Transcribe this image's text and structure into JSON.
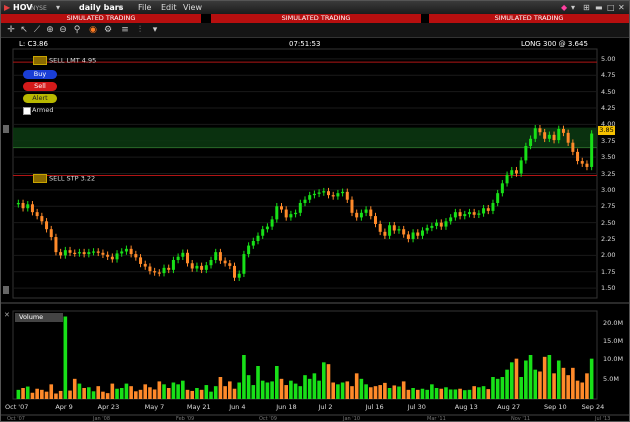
{
  "titlebar": {
    "symbol": "HOV",
    "exchange": "NYSE",
    "period": "daily bars",
    "menu": [
      "File",
      "Edit",
      "View"
    ]
  },
  "banner": [
    "SIMULATED TRADING",
    "SIMULATED TRADING",
    "SIMULATED TRADING"
  ],
  "header": {
    "last": "L: C3.86",
    "time": "07:51:53",
    "position": "LONG 300 @ 3.645"
  },
  "trade_buttons": [
    "Buy",
    "Sell",
    "Alert"
  ],
  "armed_label": "Armed",
  "orders": {
    "sell_limit": "SELL LMT 4.95",
    "sell_stop": "SELL STP 3.22"
  },
  "price_label": "3.85",
  "volume_label": "Volume",
  "volume_ticks": [
    "20.0M",
    "15.0M",
    "10.0M",
    "5.0M"
  ],
  "colors": {
    "up": "#18e018",
    "down": "#ff8a2a",
    "neutral": "#f0f000",
    "banner": "#b70f0f",
    "order_line": "#b01515"
  },
  "timeline_strip": [
    "Oct '07",
    "Jan '08",
    "Feb '09",
    "Oct '09",
    "Jan '10",
    "Mar '11",
    "Nov '11",
    "Jul '13"
  ],
  "chart_data": {
    "type": "candlestick",
    "price_axis": {
      "ticks": [
        "5.00",
        "4.75",
        "4.50",
        "4.25",
        "4.00",
        "3.75",
        "3.50",
        "3.25",
        "3.00",
        "2.75",
        "2.50",
        "2.25",
        "2.00",
        "1.75",
        "1.50"
      ],
      "ylim": [
        1.35,
        5.15
      ]
    },
    "x_ticks": [
      "Apr 9",
      "Apr 23",
      "May 7",
      "May 21",
      "Jun 4",
      "Jun 18",
      "Jul 2",
      "Jul 16",
      "Jul 30",
      "Aug 13",
      "Aug 27",
      "Sep 10",
      "Sep 24"
    ],
    "first_x_label": "Oct '07",
    "overlays": {
      "sell_limit": 4.95,
      "sell_stop": 3.22,
      "position_cost": 3.645,
      "highlight_band": [
        3.645,
        3.95
      ]
    },
    "close": [
      2.8,
      2.72,
      2.78,
      2.66,
      2.6,
      2.52,
      2.4,
      2.28,
      2.05,
      2.0,
      2.08,
      2.04,
      2.03,
      2.05,
      2.02,
      2.05,
      2.06,
      2.04,
      2.01,
      1.98,
      1.94,
      2.03,
      2.06,
      2.1,
      2.02,
      1.97,
      1.87,
      1.83,
      1.76,
      1.74,
      1.73,
      1.81,
      1.78,
      1.93,
      1.98,
      2.04,
      1.88,
      1.8,
      1.84,
      1.78,
      1.85,
      1.93,
      2.05,
      1.92,
      1.88,
      1.84,
      1.66,
      1.72,
      2.02,
      2.15,
      2.22,
      2.3,
      2.4,
      2.44,
      2.55,
      2.75,
      2.7,
      2.58,
      2.63,
      2.65,
      2.8,
      2.85,
      2.92,
      2.94,
      2.96,
      2.98,
      2.92,
      2.9,
      2.95,
      2.97,
      2.85,
      2.65,
      2.58,
      2.65,
      2.7,
      2.6,
      2.48,
      2.36,
      2.3,
      2.46,
      2.38,
      2.4,
      2.32,
      2.25,
      2.35,
      2.3,
      2.38,
      2.42,
      2.45,
      2.5,
      2.44,
      2.52,
      2.58,
      2.66,
      2.6,
      2.63,
      2.66,
      2.62,
      2.64,
      2.72,
      2.68,
      2.8,
      2.95,
      3.1,
      3.23,
      3.3,
      3.25,
      3.45,
      3.67,
      3.78,
      3.94,
      3.88,
      3.78,
      3.84,
      3.76,
      3.93,
      3.87,
      3.72,
      3.58,
      3.44,
      3.4,
      3.35,
      3.86
    ],
    "volume_millions": [
      2.5,
      3.0,
      3.4,
      1.7,
      2.8,
      2.5,
      2.0,
      4.0,
      1.5,
      2.2,
      22.5,
      2.3,
      5.5,
      4.2,
      3.0,
      3.2,
      2.1,
      3.5,
      2.0,
      1.6,
      4.2,
      2.8,
      3.0,
      4.2,
      3.5,
      2.1,
      2.5,
      4.0,
      3.2,
      2.6,
      4.8,
      4.0,
      3.0,
      4.5,
      4.0,
      5.0,
      2.5,
      2.2,
      3.0,
      2.5,
      3.8,
      2.0,
      3.5,
      6.0,
      3.5,
      4.8,
      2.8,
      4.5,
      12.0,
      6.5,
      3.8,
      9.0,
      5.0,
      4.5,
      4.8,
      9.0,
      5.5,
      3.8,
      5.0,
      4.2,
      3.5,
      6.5,
      5.5,
      7.0,
      5.0,
      10.0,
      9.5,
      4.5,
      4.0,
      4.5,
      4.8,
      3.5,
      7.0,
      5.5,
      4.0,
      3.2,
      3.5,
      3.8,
      4.4,
      3.0,
      3.7,
      3.4,
      4.8,
      2.5,
      3.0,
      2.5,
      2.8,
      2.5,
      4.0,
      3.0,
      2.8,
      3.2,
      2.6,
      2.6,
      2.8,
      2.4,
      2.5,
      3.5,
      3.2,
      3.5,
      2.7,
      6.0,
      5.5,
      6.0,
      8.0,
      10.0,
      11.0,
      6.0,
      10.5,
      12.0,
      8.0,
      7.5,
      11.5,
      12.0,
      7.0,
      10.5,
      8.5,
      6.5,
      8.5,
      5.0,
      4.5,
      7.0,
      11.0
    ]
  }
}
